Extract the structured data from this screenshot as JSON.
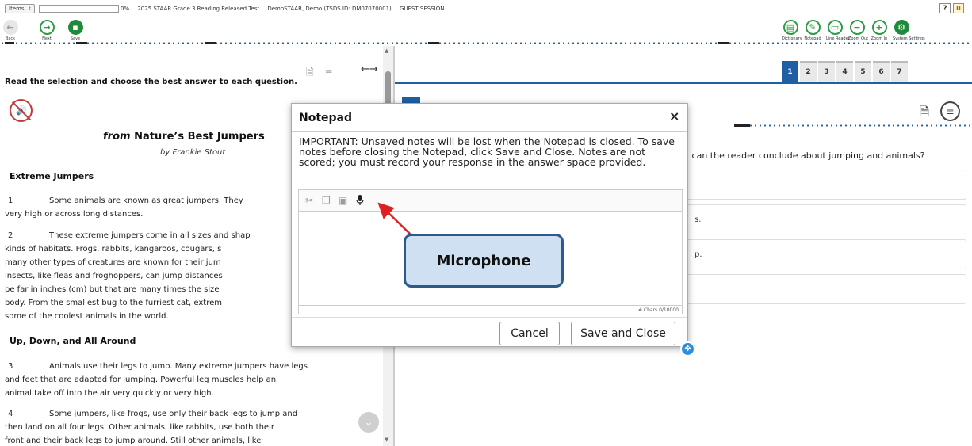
{
  "topbar": {
    "items_label": "Items",
    "progress_percent": 0,
    "progress_text": "0%",
    "test_name": "2025 STAAR Grade 3 Reading Released Test",
    "student": "DemoSTAAR, Demo (TSDS ID: DM07070001)",
    "session": "GUEST SESSION",
    "help_label": "?",
    "pause_label": "II"
  },
  "toolbar": {
    "back_label": "Back",
    "next_label": "Next",
    "save_label": "Save",
    "dictionary_label": "Dictionary",
    "notepad_label": "Notepad",
    "line_reader_label": "Line Reader",
    "zoom_out_label": "Zoom Out",
    "zoom_in_label": "Zoom In",
    "system_settings_label": "System Settings"
  },
  "passage": {
    "instructions": "Read the selection and choose the best answer to each question.",
    "title_from": "from",
    "title": "Nature’s Best Jumpers",
    "byline": "by Frankie Stout",
    "heading1": "Extreme Jumpers",
    "heading2": "Up, Down, and All Around",
    "paragraphs": [
      {
        "num": "1",
        "text": "Some animals are known as great jumpers. They",
        "text2": "very high or across long distances."
      },
      {
        "num": "2",
        "text": "These extreme jumpers come in all sizes and shap",
        "lines": [
          "kinds of habitats. Frogs, rabbits, kangaroos, cougars, s",
          "many other types of creatures are known for their jum",
          "insects, like fleas and froghoppers, can jump distances",
          "be far in inches (cm) but that are many times the size",
          "body. From the smallest bug to the furriest cat, extrem",
          "some of the coolest animals in the world."
        ]
      },
      {
        "num": "3",
        "text": "Animals use their legs to jump. Many extreme jumpers have legs",
        "lines": [
          "and feet that are adapted for jumping. Powerful leg muscles help an",
          "animal take off into the air very quickly or very high."
        ]
      },
      {
        "num": "4",
        "text": "Some jumpers, like frogs, use only their back legs to jump and",
        "lines": [
          "then land on all four legs. Other animals, like rabbits, use both their",
          "front and their back legs to jump around. Still other animals, like"
        ]
      }
    ]
  },
  "question": {
    "tabs": [
      "1",
      "2",
      "3",
      "4",
      "5",
      "6",
      "7"
    ],
    "active_tab": "1",
    "prompt_visible": "at can the reader conclude about jumping and animals?",
    "choice_fragments": [
      "",
      "s.",
      "p.",
      ""
    ]
  },
  "notepad": {
    "title": "Notepad",
    "close_label": "×",
    "message": "IMPORTANT: Unsaved notes will be lost when the Notepad is closed. To save notes before closing the Notepad, click Save and Close. Notes are not scored; you must record your response in the answer space provided.",
    "char_count": "# Chars 0/10000",
    "cancel_label": "Cancel",
    "save_close_label": "Save and Close"
  },
  "callout": {
    "label": "Microphone"
  },
  "colors": {
    "accent_blue": "#1f5fa3",
    "toolbar_green": "#1e8b3a",
    "callout_fill": "#cfe0f2",
    "callout_border": "#2d5a8c",
    "arrow_red": "#e02020"
  }
}
